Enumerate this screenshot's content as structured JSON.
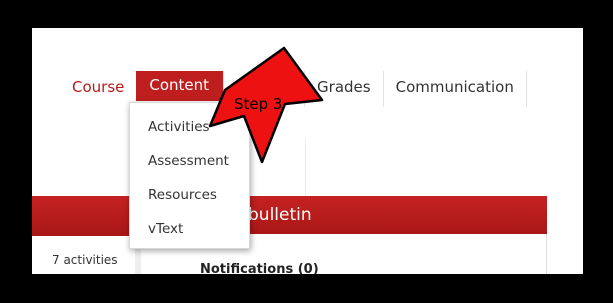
{
  "nav": {
    "items": [
      {
        "label": "Course"
      },
      {
        "label": "Content"
      },
      {
        "label": "Grades"
      },
      {
        "label": "Communication"
      }
    ]
  },
  "dropdown": {
    "items": [
      {
        "label": "Activities"
      },
      {
        "label": "Assessment"
      },
      {
        "label": "Resources"
      },
      {
        "label": "vText"
      }
    ]
  },
  "bulletin": {
    "title": "bulletin",
    "notifications": "Notifications (0)"
  },
  "sidebar": {
    "activities_count": "7 activities"
  },
  "annotation": {
    "label": "Step 3"
  },
  "colors": {
    "accent": "#be1e1e",
    "border": "#000000",
    "annotation_arrow": "#ee1111"
  }
}
